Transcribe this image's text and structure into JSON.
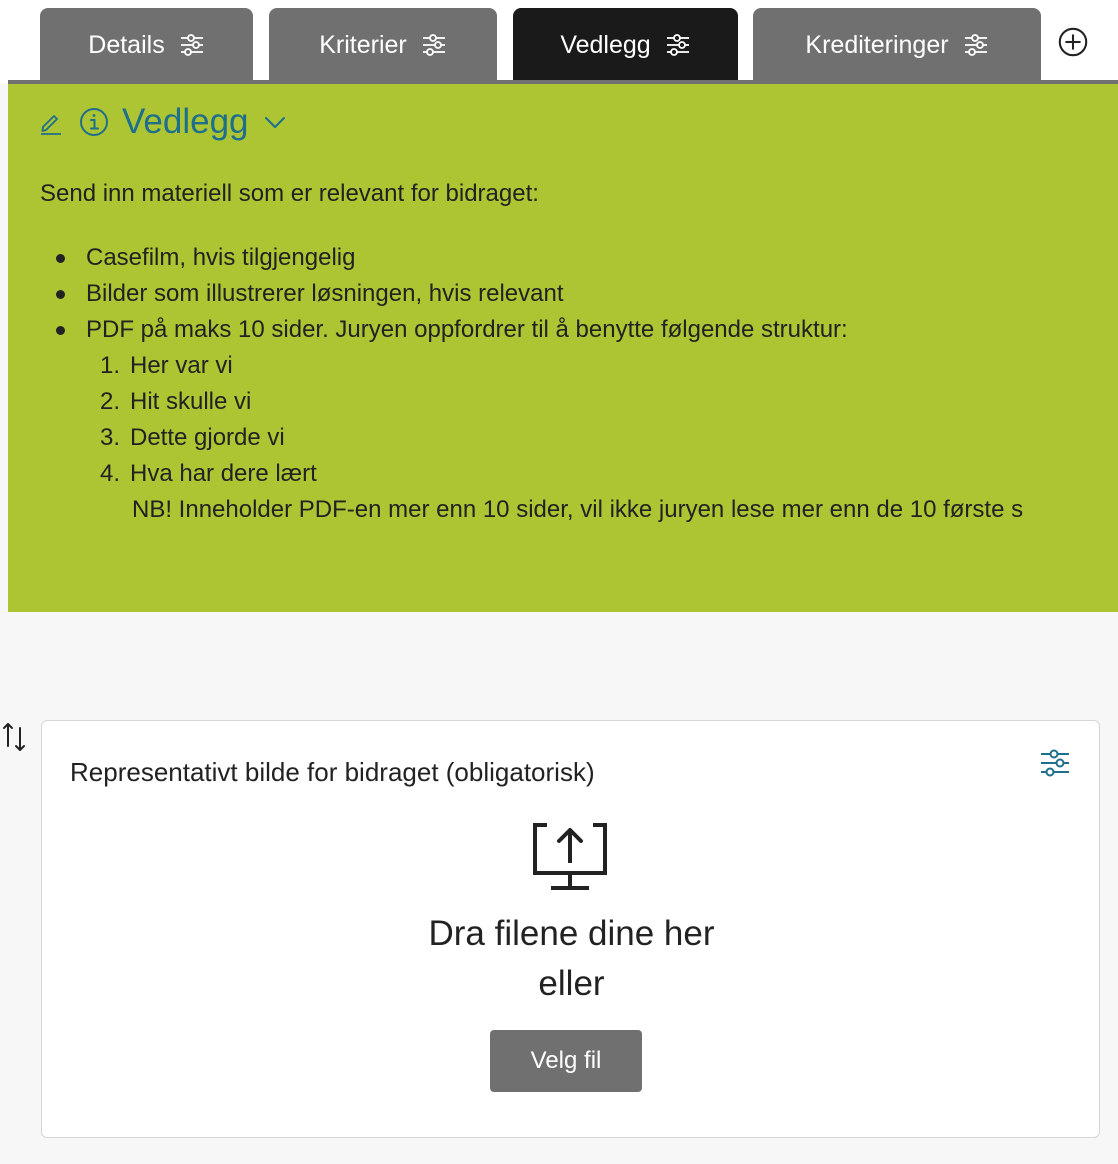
{
  "tabs": [
    {
      "label": "Details",
      "active": false
    },
    {
      "label": "Kriterier",
      "active": false
    },
    {
      "label": "Vedlegg",
      "active": true
    },
    {
      "label": "Krediteringer",
      "active": false
    }
  ],
  "info_panel": {
    "title": "Vedlegg",
    "background_color": "#adc532",
    "title_color": "#1d6f8c",
    "intro": "Send inn materiell som er relevant for bidraget:",
    "bullets": [
      "Casefilm, hvis tilgjengelig",
      "Bilder som illustrerer løsningen, hvis relevant",
      "PDF på maks 10 sider. Juryen oppfordrer til å benytte følgende struktur:"
    ],
    "structure": [
      {
        "num": "1.",
        "text": "Her var vi"
      },
      {
        "num": "2.",
        "text": "Hit skulle vi"
      },
      {
        "num": "3.",
        "text": "Dette gjorde vi"
      },
      {
        "num": "4.",
        "text": "Hva har dere lært"
      }
    ],
    "note": "NB! Inneholder PDF-en mer enn 10 sider, vil ikke juryen lese mer enn de 10 første s"
  },
  "upload_field": {
    "title": "Representativt bilde for bidraget (obligatorisk)",
    "drop_line_1": "Dra filene dine her",
    "drop_line_2": "eller",
    "button_label": "Velg fil"
  },
  "icons": {
    "tab_settings": "sliders-icon",
    "add_tab": "plus-circle-icon",
    "edit": "pencil-icon",
    "info": "info-circle-icon",
    "collapse": "chevron-down-icon",
    "sort": "sort-arrows-icon",
    "card_settings": "sliders-icon",
    "upload": "upload-monitor-icon"
  },
  "colors": {
    "tab_inactive": "#707070",
    "tab_active": "#1a1a1a",
    "button": "#707070"
  }
}
